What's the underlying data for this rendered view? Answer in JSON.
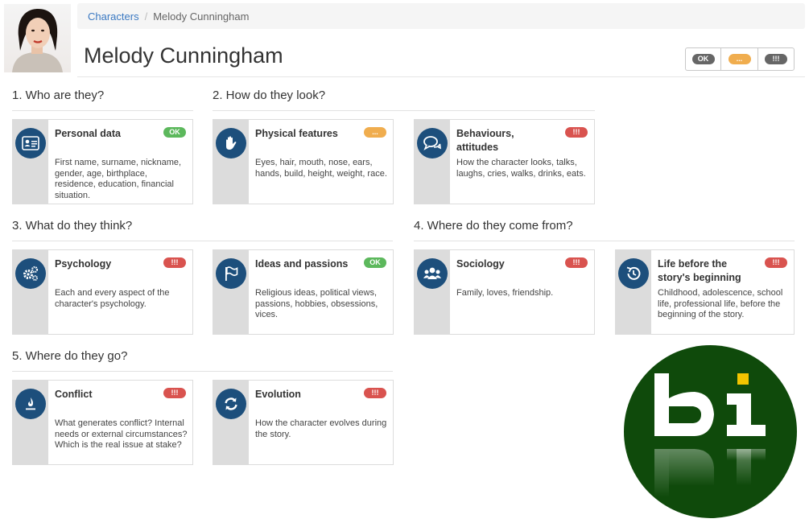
{
  "breadcrumb": {
    "parent": "Characters",
    "current": "Melody Cunningham"
  },
  "title": "Melody Cunningham",
  "status_filter": [
    "OK",
    "...",
    "!!!"
  ],
  "colors": {
    "ok": "#5cb85c",
    "pending": "#f0ad4e",
    "alert": "#d9534f",
    "icon_bg": "#1d4f7c",
    "logo_bg": "#0f4a0b"
  },
  "sections": [
    {
      "title": "1. Who are they?"
    },
    {
      "title": "2. How do they look?"
    },
    {
      "title": "3. What do they think?"
    },
    {
      "title": "4. Where do they come from?"
    },
    {
      "title": "5. Where do they go?"
    }
  ],
  "cards": [
    {
      "icon": "id-card-icon",
      "title": "Personal data",
      "status": "OK",
      "desc": "First name, surname, nickname, gender, age, birthplace, residence, education, financial situation."
    },
    {
      "icon": "hand-icon",
      "title": "Physical features",
      "status": "...",
      "desc": "Eyes, hair, mouth, nose, ears, hands, build, height, weight, race."
    },
    {
      "icon": "speech-bubbles-icon",
      "title": "Behaviours, attitudes",
      "status": "!!!",
      "desc": "How the character looks, talks, laughs, cries, walks, drinks, eats."
    },
    {
      "icon": "gears-icon",
      "title": "Psychology",
      "status": "!!!",
      "desc": "Each and every aspect of the character's psychology."
    },
    {
      "icon": "flag-icon",
      "title": "Ideas and passions",
      "status": "OK",
      "desc": "Religious ideas, political views, passions, hobbies, obsessions, vices."
    },
    {
      "icon": "users-icon",
      "title": "Sociology",
      "status": "!!!",
      "desc": "Family, loves, friendship."
    },
    {
      "icon": "history-icon",
      "title": "Life before the story's beginning",
      "status": "!!!",
      "desc": "Childhood, adolescence, school life, professional life, before the beginning of the story."
    },
    {
      "icon": "fire-icon",
      "title": "Conflict",
      "status": "!!!",
      "desc": "What generates conflict? Internal needs or external circumstances? Which is the real issue at stake?"
    },
    {
      "icon": "refresh-icon",
      "title": "Evolution",
      "status": "!!!",
      "desc": "How the character evolves during the story."
    }
  ],
  "logo": {
    "text": "bi"
  }
}
